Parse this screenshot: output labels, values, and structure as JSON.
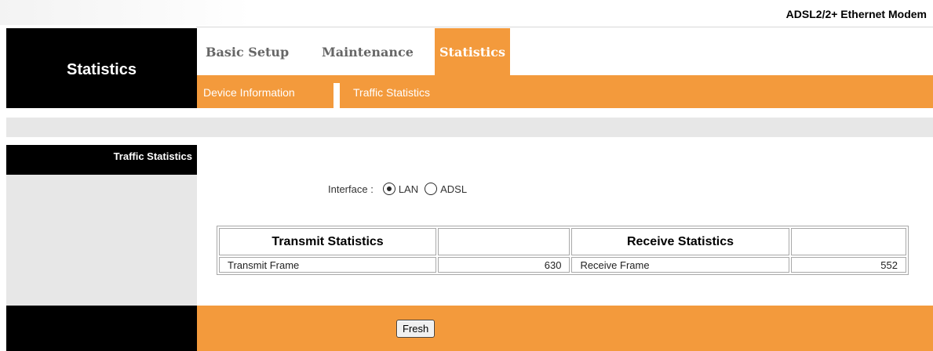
{
  "header": {
    "product_name": "ADSL2/2+ Ethernet Modem",
    "section_title": "Statistics"
  },
  "main_tabs": [
    {
      "label": "Basic Setup",
      "active": false
    },
    {
      "label": "Maintenance",
      "active": false
    },
    {
      "label": "Statistics",
      "active": true
    }
  ],
  "sub_tabs": [
    {
      "label": "Device Information"
    },
    {
      "label": "Traffic Statistics"
    }
  ],
  "sidebar": {
    "label": "Traffic Statistics"
  },
  "interface": {
    "label": "Interface :",
    "options": [
      {
        "label": "LAN",
        "selected": true
      },
      {
        "label": "ADSL",
        "selected": false
      }
    ]
  },
  "stats_table": {
    "headers": [
      "Transmit Statistics",
      "",
      "Receive Statistics",
      ""
    ],
    "rows": [
      [
        "Transmit Frame",
        "630",
        "Receive Frame",
        "552"
      ]
    ]
  },
  "actions": {
    "fresh_label": "Fresh"
  },
  "colors": {
    "accent_orange": "#f39a3c",
    "header_black": "#000000",
    "panel_grey": "#e7e7e7"
  }
}
